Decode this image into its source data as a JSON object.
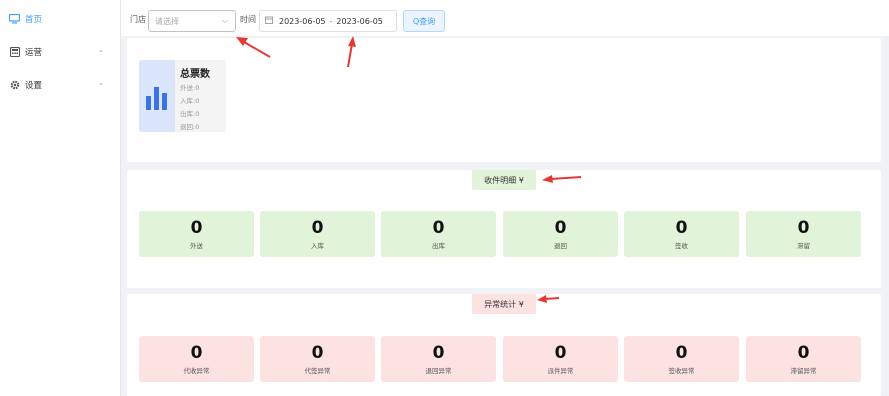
{
  "sidebar": {
    "items": [
      {
        "label": "首页",
        "icon": "monitor-icon",
        "active": true
      },
      {
        "label": "运营",
        "icon": "calculator-icon",
        "expandable": true
      },
      {
        "label": "设置",
        "icon": "gear-icon",
        "expandable": true
      }
    ]
  },
  "filters": {
    "store_label": "门店",
    "store_placeholder": "请选择",
    "time_label": "时间",
    "start_date": "2023-06-05",
    "end_date": "2023-06-05",
    "query_label": "Q查询"
  },
  "summary": {
    "title": "总票数",
    "rows": [
      {
        "label": "外送",
        "value": "0"
      },
      {
        "label": "入库",
        "value": "0"
      },
      {
        "label": "出库",
        "value": "0"
      },
      {
        "label": "退回",
        "value": "0"
      }
    ]
  },
  "receive": {
    "tab_label": "收件明细 ¥",
    "stats": [
      {
        "value": "0",
        "label": "外送"
      },
      {
        "value": "0",
        "label": "入库"
      },
      {
        "value": "0",
        "label": "出库"
      },
      {
        "value": "0",
        "label": "退回"
      },
      {
        "value": "0",
        "label": "签收"
      },
      {
        "value": "0",
        "label": "滞留"
      }
    ]
  },
  "exception": {
    "tab_label": "异常统计 ¥",
    "stats": [
      {
        "value": "0",
        "label": "代收异常"
      },
      {
        "value": "0",
        "label": "代签异常"
      },
      {
        "value": "0",
        "label": "退回异常"
      },
      {
        "value": "0",
        "label": "派件异常"
      },
      {
        "value": "0",
        "label": "签收异常"
      },
      {
        "value": "0",
        "label": "滞留异常"
      }
    ]
  },
  "colors": {
    "accent": "#409eff",
    "green_tile": "#e1f3d8",
    "red_tile": "#fde2e2",
    "arrow_red": "#e53935"
  }
}
